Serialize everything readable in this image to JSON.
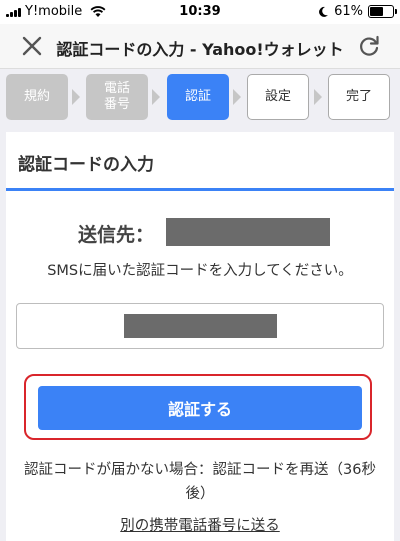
{
  "status": {
    "carrier": "Y!mobile",
    "time": "10:39",
    "battery": "61%",
    "battery_level": 0.61
  },
  "nav": {
    "title": "認証コードの入力 - Yahoo!ウォレット",
    "close_icon": "close-icon",
    "reload_icon": "reload-icon"
  },
  "steps": [
    {
      "label": "規約",
      "state": "done"
    },
    {
      "label": "電話\n番号",
      "state": "done"
    },
    {
      "label": "認証",
      "state": "active"
    },
    {
      "label": "設定",
      "state": "todo"
    },
    {
      "label": "完了",
      "state": "todo"
    }
  ],
  "card": {
    "heading": "認証コードの入力",
    "destination_label": "送信先：",
    "instruction": "SMSに届いた認証コードを入力してください。",
    "verify_button": "認証する",
    "resend_text": "認証コードが届かない場合：認証コードを再送（36秒後）",
    "other_phone_link": "別の携帯電話番号に送る"
  },
  "colors": {
    "accent": "#3b82f6",
    "highlight": "#d9252b",
    "step_done": "#c6c6c6"
  }
}
